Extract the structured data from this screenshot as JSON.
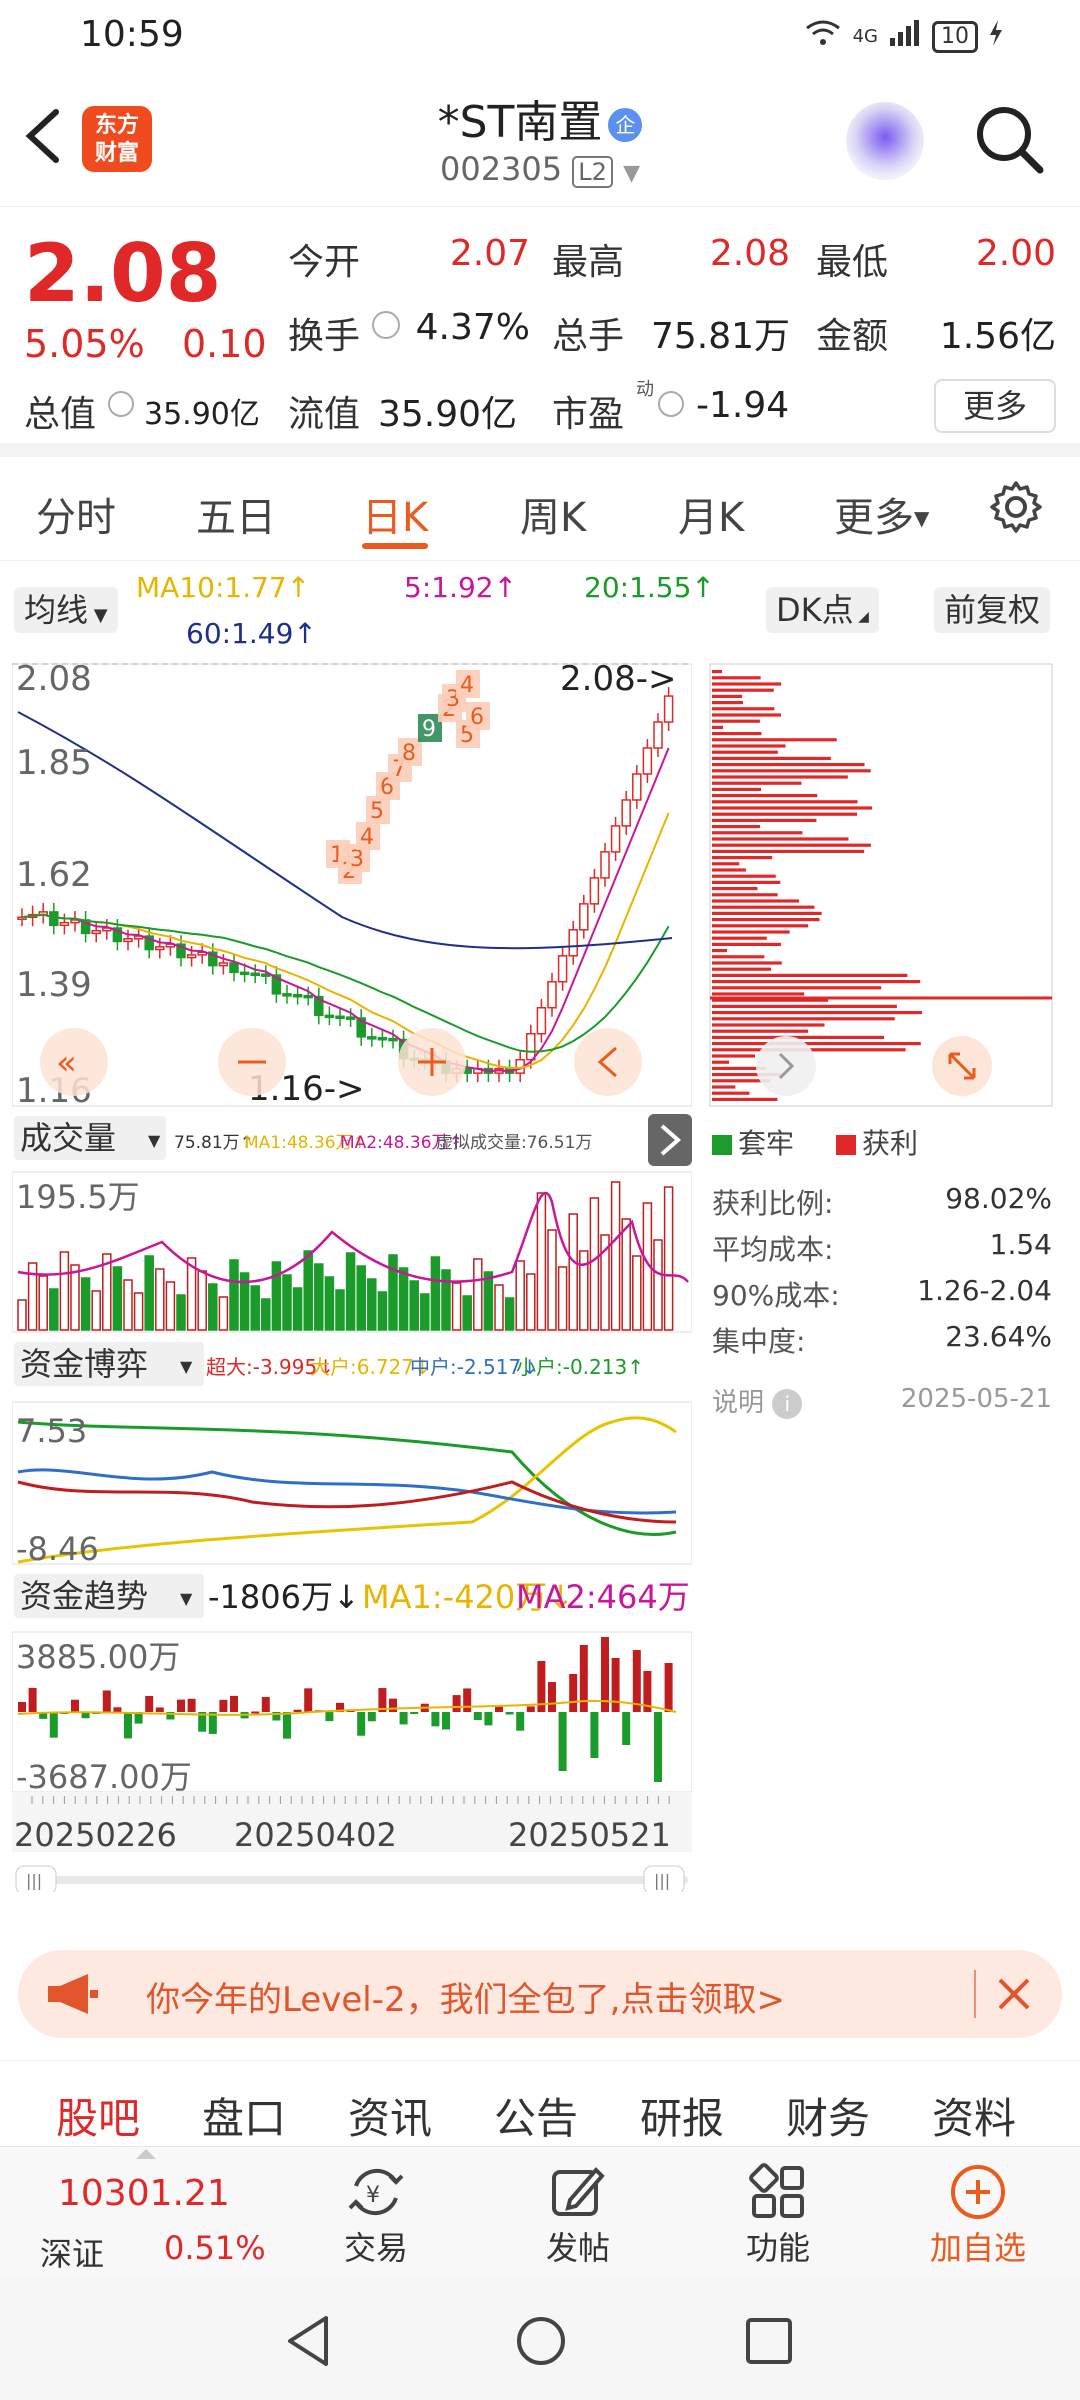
{
  "status_bar": {
    "time": "10:59",
    "network": "4G",
    "battery": "10"
  },
  "header": {
    "logo_line1": "东方",
    "logo_line2": "财富",
    "stock_name": "*ST南置",
    "badge": "企",
    "stock_code": "002305",
    "level": "L2"
  },
  "quote": {
    "price": "2.08",
    "change_pct": "5.05%",
    "change": "0.10",
    "open_label": "今开",
    "open": "2.07",
    "high_label": "最高",
    "high": "2.08",
    "low_label": "最低",
    "low": "2.00",
    "turnover_label": "换手",
    "turnover": "4.37%",
    "volume_label": "总手",
    "volume": "75.81万",
    "amount_label": "金额",
    "amount": "1.56亿",
    "mcap_label": "总值",
    "mcap": "35.90亿",
    "float_label": "流值",
    "float_cap": "35.90亿",
    "pe_label": "市盈",
    "pe_sup": "动",
    "pe": "-1.94",
    "more": "更多"
  },
  "tabs": [
    "分时",
    "五日",
    "日K",
    "周K",
    "月K",
    "更多"
  ],
  "active_tab": "日K",
  "ma": {
    "selector": "均线",
    "ma10": "MA10:1.77↑",
    "ma5": "5:1.92↑",
    "ma20": "20:1.55↑",
    "ma60": "60:1.49↑",
    "dk": "DK点",
    "adjust": "前复权"
  },
  "price_chart": {
    "y_labels": [
      "2.08",
      "1.85",
      "1.62",
      "1.39",
      "1.16"
    ],
    "high_marker": "2.08->",
    "low_marker": "1.16->",
    "seq_numbers": [
      "1",
      "2",
      "3",
      "4",
      "5",
      "6",
      "7",
      "8",
      "9",
      "2",
      "3",
      "4",
      "5",
      "6"
    ]
  },
  "volume": {
    "selector": "成交量",
    "info": "75.81万↑",
    "ma1": "MA1:48.36万↑",
    "ma2": "MA2:48.36万↑",
    "virtual": "虚拟成交量:76.51万",
    "y_label": "195.5万"
  },
  "fund_game": {
    "selector": "资金博弈",
    "super": "超大:-3.995↓",
    "large": "大户:6.727↓",
    "mid": "中户:-2.517↓",
    "small": "小户:-0.213↑",
    "y_top": "7.53",
    "y_bottom": "-8.46"
  },
  "fund_trend": {
    "selector": "资金趋势",
    "value": "-1806万↓",
    "ma1": "MA1:-420万↓",
    "ma2": "MA2:464万↓",
    "y_top": "3885.00万",
    "y_bottom": "-3687.00万"
  },
  "dates": [
    "20250226",
    "20250402",
    "20250521"
  ],
  "chip": {
    "legend_locked": "套牢",
    "legend_profit": "获利",
    "stats": [
      {
        "label": "获利比例:",
        "value": "98.02%"
      },
      {
        "label": "平均成本:",
        "value": "1.54"
      },
      {
        "label": "90%成本:",
        "value": "1.26-2.04"
      },
      {
        "label": "集中度:",
        "value": "23.64%"
      }
    ],
    "note": "说明",
    "date": "2025-05-21"
  },
  "banner": {
    "text": "你今年的Level-2，我们全包了,点击领取>"
  },
  "bottom_tabs": [
    "股吧",
    "盘口",
    "资讯",
    "公告",
    "研报",
    "财务",
    "资料"
  ],
  "index": {
    "value": "10301.21",
    "name": "深证",
    "pct": "0.51%"
  },
  "toolbar": {
    "trade": "交易",
    "post": "发帖",
    "func": "功能",
    "watch": "加自选"
  },
  "colors": {
    "red": "#e02828",
    "green": "#1a9b2a",
    "accent": "#e95b1e"
  }
}
